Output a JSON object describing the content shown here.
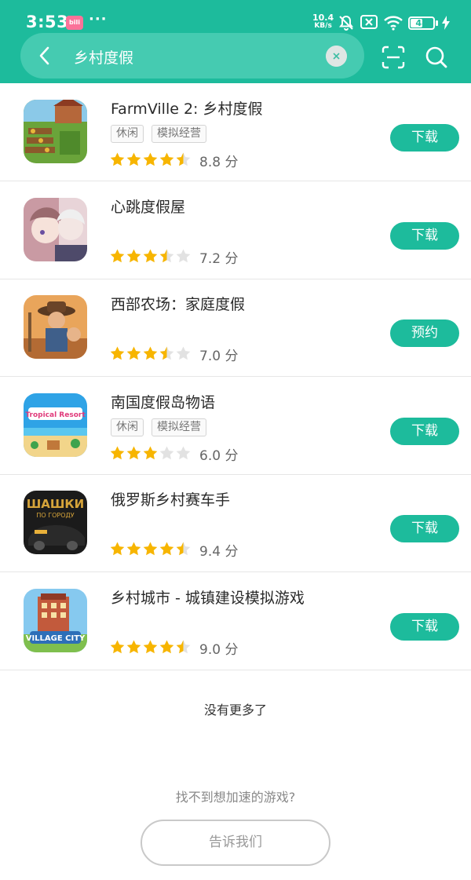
{
  "status_bar": {
    "time": "3:53",
    "notification_app": "bilibili",
    "more_indicator": "···",
    "net_speed_value": "10.4",
    "net_speed_unit": "KB/s",
    "battery": "48",
    "icons": [
      "mute-bell-icon",
      "no-sim-icon",
      "wifi-icon",
      "battery-icon",
      "charging-icon"
    ]
  },
  "search": {
    "query": "乡村度假",
    "icons": [
      "back-arrow-icon",
      "clear-icon",
      "scan-icon",
      "search-icon"
    ]
  },
  "results": [
    {
      "title": "FarmVille 2: 乡村度假",
      "tags": [
        "休闲",
        "模拟经营"
      ],
      "rating": 4.5,
      "score": "8.8 分",
      "action": "下载"
    },
    {
      "title": "心跳度假屋",
      "tags": [],
      "rating": 3.5,
      "score": "7.2 分",
      "action": "下载"
    },
    {
      "title": "西部农场：家庭度假",
      "tags": [],
      "rating": 3.5,
      "score": "7.0 分",
      "action": "预约"
    },
    {
      "title": "南国度假岛物语",
      "tags": [
        "休闲",
        "模拟经营"
      ],
      "rating": 3,
      "score": "6.0 分",
      "action": "下载"
    },
    {
      "title": "俄罗斯乡村赛车手",
      "tags": [],
      "rating": 4.5,
      "score": "9.4 分",
      "action": "下载"
    },
    {
      "title": "乡村城市 - 城镇建设模拟游戏",
      "tags": [],
      "rating": 4.5,
      "score": "9.0 分",
      "action": "下载"
    }
  ],
  "footer": {
    "no_more": "没有更多了",
    "cant_find": "找不到想加速的游戏?",
    "tell_us": "告诉我们"
  },
  "colors": {
    "accent": "#1dbb9c",
    "star": "#f7b500",
    "star_empty": "#e2e2e2"
  }
}
